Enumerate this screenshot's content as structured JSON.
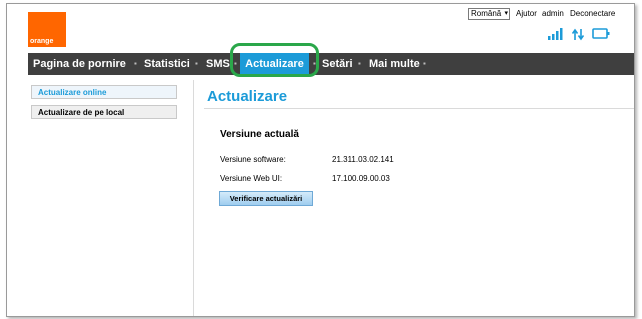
{
  "header": {
    "logo_text": "orange",
    "language": "Română",
    "help_link": "Ajutor",
    "user": "admin",
    "logout_link": "Deconectare",
    "icons": [
      "signal-bars-icon",
      "data-transfer-icon",
      "monitor-icon"
    ]
  },
  "nav": {
    "items": [
      "Pagina de pornire",
      "Statistici",
      "SMS",
      "Actualizare",
      "Setări",
      "Mai multe"
    ],
    "active": "Actualizare",
    "separator": "ׁ"
  },
  "sidebar": {
    "items": [
      "Actualizare online",
      "Actualizare de pe local"
    ],
    "selected": "Actualizare online"
  },
  "main": {
    "title": "Actualizare",
    "section_title": "Versiune actuală",
    "rows": [
      {
        "label": "Versiune software:",
        "value": "21.311.03.02.141"
      },
      {
        "label": "Versiune Web UI:",
        "value": "17.100.09.00.03"
      }
    ],
    "check_button": "Verificare actualizări"
  },
  "colors": {
    "brand_orange": "#ff6600",
    "accent_blue": "#1c9bd8",
    "nav_bg": "#3f3f3f",
    "highlight_green": "#2aa74a"
  }
}
